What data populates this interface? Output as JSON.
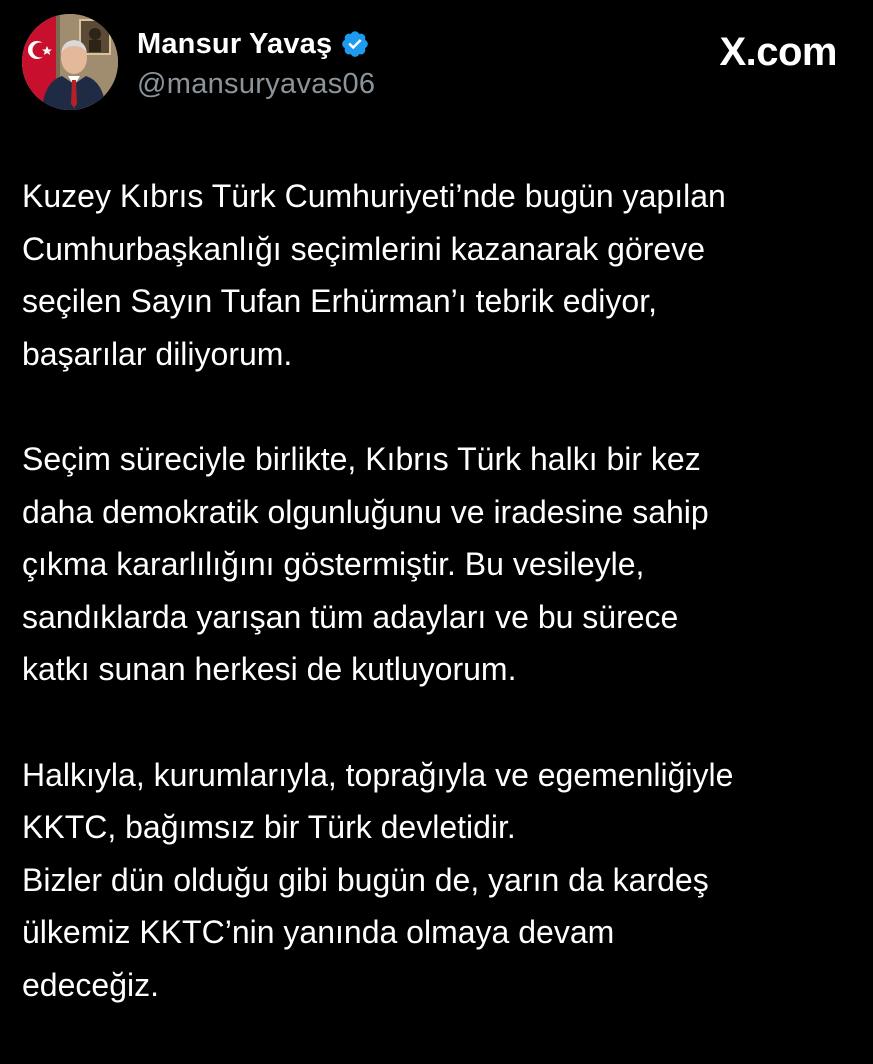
{
  "post": {
    "author": {
      "display_name": "Mansur Yavaş",
      "handle": "@mansuryavas06",
      "verified_icon": "verified-badge-icon",
      "verified_color": "#1d9bf0"
    },
    "brand": "X.com",
    "paragraphs": [
      {
        "lines": [
          "Kuzey Kıbrıs Türk Cumhuriyeti’nde bugün yapılan",
          "Cumhurbaşkanlığı seçimlerini kazanarak göreve",
          "seçilen Sayın Tufan Erhürman’ı tebrik ediyor,",
          "başarılar diliyorum."
        ]
      },
      {
        "lines": [
          "Seçim süreciyle birlikte, Kıbrıs Türk halkı bir kez",
          "daha demokratik olgunluğunu ve iradesine sahip",
          "çıkma kararlılığını göstermiştir. Bu vesileyle,",
          "sandıklarda yarışan tüm adayları ve bu sürece",
          "katkı sunan herkesi de kutluyorum."
        ]
      },
      {
        "lines": [
          "Halkıyla, kurumlarıyla, toprağıyla ve egemenliğiyle",
          "KKTC, bağımsız bir Türk devletidir.",
          "Bizler dün olduğu gibi bugün de, yarın da kardeş",
          "ülkemiz KKTC’nin yanında olmaya devam",
          "edeceğiz."
        ]
      }
    ]
  },
  "colors": {
    "background": "#000000",
    "text": "#ffffff",
    "handle": "#8b949b"
  }
}
